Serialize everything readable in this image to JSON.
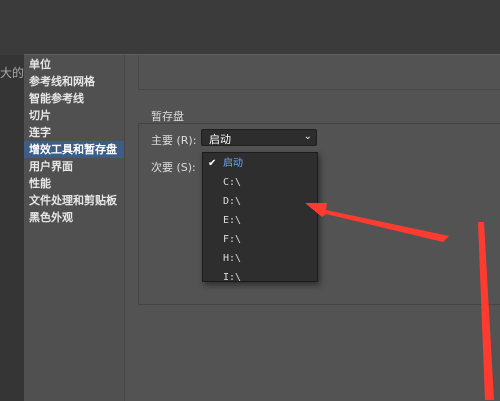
{
  "background": {
    "left_fragment": "大的"
  },
  "sidebar": {
    "items": [
      {
        "label": "单位"
      },
      {
        "label": "参考线和网格"
      },
      {
        "label": "智能参考线"
      },
      {
        "label": "切片"
      },
      {
        "label": "连字"
      },
      {
        "label": "增效工具和暂存盘",
        "selected": true
      },
      {
        "label": "用户界面"
      },
      {
        "label": "性能"
      },
      {
        "label": "文件处理和剪贴板"
      },
      {
        "label": "黑色外观"
      }
    ]
  },
  "scratch_disks": {
    "title": "暂存盘",
    "primary": {
      "label": "主要 (R):",
      "value": "启动"
    },
    "secondary": {
      "label": "次要 (S):"
    },
    "options": [
      {
        "label": "启动",
        "checked": true
      },
      {
        "label": "C:\\"
      },
      {
        "label": "D:\\"
      },
      {
        "label": "E:\\"
      },
      {
        "label": "F:\\"
      },
      {
        "label": "H:\\"
      },
      {
        "label": "I:\\"
      }
    ]
  },
  "colors": {
    "selection": "#3e5d85",
    "annotation_arrow": "#ff3b30",
    "checked_option": "#6aa6ff"
  }
}
